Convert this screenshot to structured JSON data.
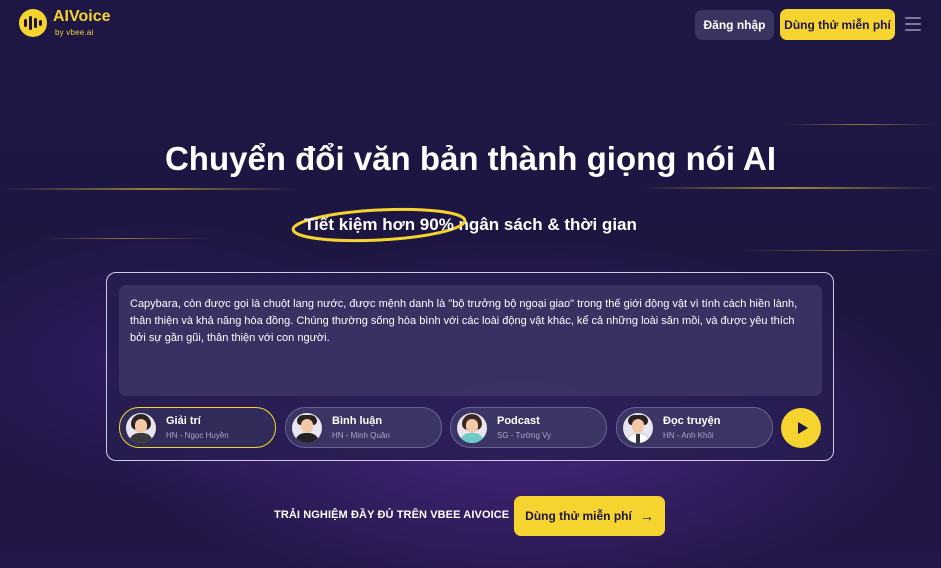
{
  "header": {
    "logo_name": "AIVoice",
    "logo_by": "by vbee.ai",
    "login_label": "Đăng nhập",
    "try_free_label": "Dùng thử miễn phí",
    "menu_icon": "hamburger-icon"
  },
  "hero": {
    "title": "Chuyển đổi văn bản thành giọng nói AI",
    "subtitle_highlight": "Tiết kiệm hơn 90%",
    "subtitle_rest": " ngân sách & thời gian"
  },
  "editor": {
    "text": "Capybara, còn được gọi là chuột lang nước, được mệnh danh là \"bộ trưởng bộ ngoại giao\" trong thế giới động vật vì tính cách hiền lành, thân thiện và khả năng hòa đồng. Chúng thường sống hòa bình với các loài động vật khác, kể cả những loài săn mồi, và được yêu thích bởi sự gần gũi, thân thiện với con người.",
    "voices": [
      {
        "name": "Giải trí",
        "meta": "HN - Ngọc Huyền"
      },
      {
        "name": "Bình luận",
        "meta": "HN - Minh Quân"
      },
      {
        "name": "Podcast",
        "meta": "SG - Tường Vy"
      },
      {
        "name": "Đọc truyện",
        "meta": "HN - Anh Khôi"
      }
    ],
    "play_icon": "play-icon"
  },
  "cta": {
    "text": "TRẢI NGHIỆM ĐẦY ĐỦ TRÊN VBEE AIVOICE",
    "button_label": "Dùng thử miễn phí",
    "arrow": "→"
  },
  "colors": {
    "accent": "#f6d430",
    "background": "#1d1540"
  }
}
